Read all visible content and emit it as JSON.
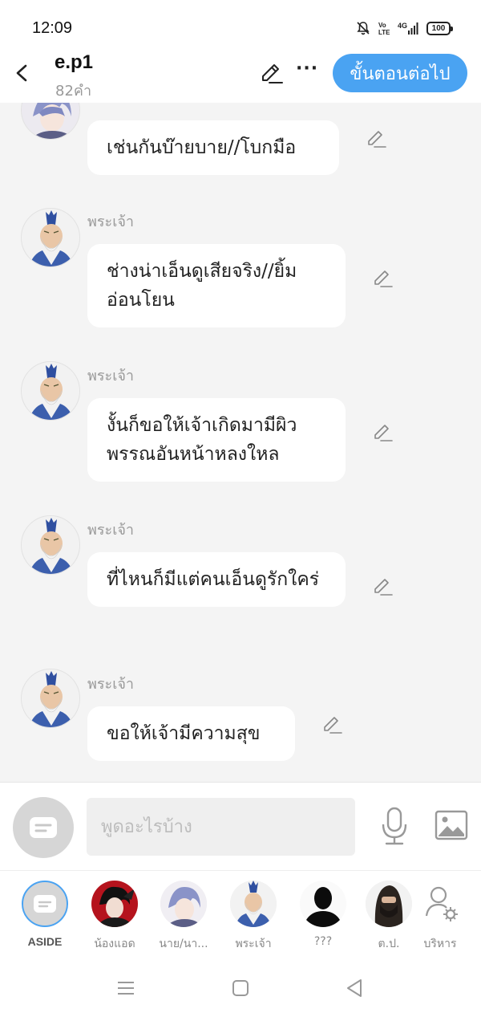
{
  "status": {
    "time": "12:09",
    "battery": "100"
  },
  "header": {
    "title": "e.p1",
    "word_count": "82คำ",
    "next_label": "ขั้นตอนต่อไป"
  },
  "messages": [
    {
      "sender": "",
      "text": "เช่นกันบ๊ายบาย//โบกมือ",
      "avatar": "boy-character-avatar"
    },
    {
      "sender": "พระเจ้า",
      "text": "ช่างน่าเอ็นดูเสียจริง//ยิ้มอ่อนโยน",
      "avatar": "god-avatar"
    },
    {
      "sender": "พระเจ้า",
      "text": "งั้นก็ขอให้เจ้าเกิดมามีผิวพรรณอันหน้าหลงใหล",
      "avatar": "god-avatar"
    },
    {
      "sender": "พระเจ้า",
      "text": "ที่ไหนก็มีแต่คนเอ็นดูรักใคร่",
      "avatar": "god-avatar"
    },
    {
      "sender": "พระเจ้า",
      "text": "ขอให้เจ้ามีความสุข",
      "avatar": "god-avatar"
    }
  ],
  "input": {
    "placeholder": "พูดอะไรบ้าง"
  },
  "characters": [
    {
      "label": "ASIDE",
      "icon": "aside-icon",
      "selected": true
    },
    {
      "label": "น้องแอด",
      "icon": "red-black-character-avatar"
    },
    {
      "label": "นาย/นา...",
      "icon": "boy-character-avatar"
    },
    {
      "label": "พระเจ้า",
      "icon": "god-avatar"
    },
    {
      "label": "???",
      "icon": "silhouette-avatar"
    },
    {
      "label": "ต.ป.",
      "icon": "hooded-character-avatar"
    },
    {
      "label": "บริหาร",
      "icon": "manage-characters-icon"
    }
  ],
  "colors": {
    "accent": "#4aa3f2",
    "background": "#f4f4f4",
    "bubble": "#ffffff",
    "muted": "#999999"
  }
}
